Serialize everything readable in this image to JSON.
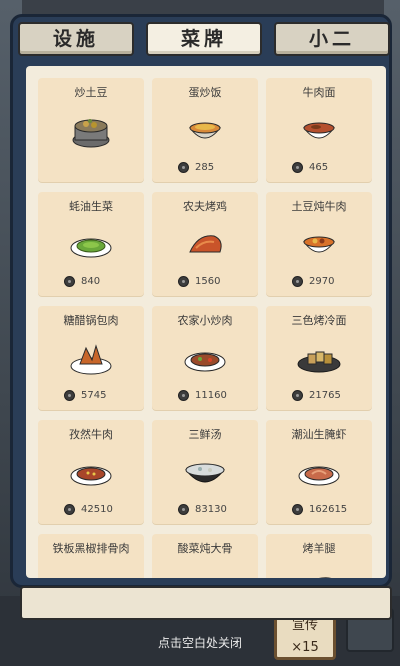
{
  "tabs": [
    {
      "label": "设施"
    },
    {
      "label": "菜牌"
    },
    {
      "label": "小二"
    }
  ],
  "menu": [
    {
      "name": "炒土豆",
      "price": ""
    },
    {
      "name": "蛋炒饭",
      "price": "285"
    },
    {
      "name": "牛肉面",
      "price": "465"
    },
    {
      "name": "蚝油生菜",
      "price": "840"
    },
    {
      "name": "农夫烤鸡",
      "price": "1560"
    },
    {
      "name": "土豆炖牛肉",
      "price": "2970"
    },
    {
      "name": "糖醋锅包肉",
      "price": "5745"
    },
    {
      "name": "农家小炒肉",
      "price": "11160"
    },
    {
      "name": "三色烤冷面",
      "price": "21765"
    },
    {
      "name": "孜然牛肉",
      "price": "42510"
    },
    {
      "name": "三鲜汤",
      "price": "83130"
    },
    {
      "name": "潮汕生腌虾",
      "price": "162615"
    },
    {
      "name": "铁板黑椒排骨肉",
      "price": ""
    },
    {
      "name": "酸菜炖大骨",
      "price": ""
    },
    {
      "name": "烤羊腿",
      "price": ""
    }
  ],
  "close_hint": "点击空白处关闭",
  "background_sign": {
    "line1": "宣传",
    "line2": "×15"
  }
}
